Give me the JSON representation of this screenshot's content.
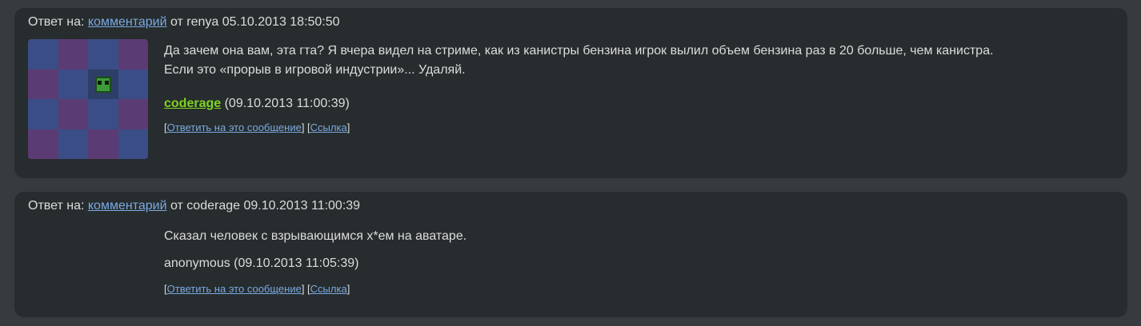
{
  "comments": [
    {
      "reply_prefix": "Ответ на:",
      "reply_link": "комментарий",
      "reply_suffix": "от renya 05.10.2013 18:50:50",
      "text_line1": "Да зачем она вам, эта гта? Я вчера видел на стриме, как из канистры бензина игрок вылил объем бензина раз в 20 больше, чем канистра.",
      "text_line2": "Если это «прорыв в игровой индустрии»... Удаляй.",
      "author": "coderage",
      "date": "(09.10.2013 11:00:39)",
      "reply_action": "Ответить на это сообщение",
      "link_action": "Ссылка",
      "avatar_icon": "creeper-avatar-icon"
    },
    {
      "reply_prefix": "Ответ на:",
      "reply_link": "комментарий",
      "reply_suffix": "от coderage 09.10.2013 11:00:39",
      "text_line1": "Сказал человек с взрывающимся х*ем на аватаре.",
      "author": "anonymous",
      "date": "(09.10.2013 11:05:39)",
      "reply_action": "Ответить на это сообщение",
      "link_action": "Ссылка"
    }
  ],
  "colors": {
    "page_bg": "#373b3d",
    "card_bg": "#272c2e",
    "link": "#7aa9e0",
    "author_link": "#7ed321",
    "text": "#dcdcdc"
  }
}
